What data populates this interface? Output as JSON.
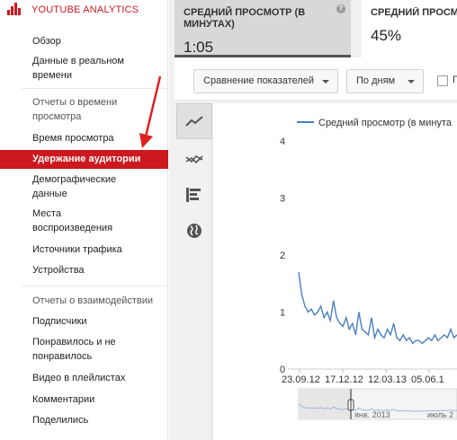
{
  "sidebar": {
    "title": "YOUTUBE ANALYTICS",
    "items": [
      {
        "label": "Обзор",
        "type": "item"
      },
      {
        "label": "Данные в реальном времени",
        "type": "item"
      },
      {
        "label": "Отчеты о времени просмотра",
        "type": "section"
      },
      {
        "label": "Время просмотра",
        "type": "item"
      },
      {
        "label": "Удержание аудитории",
        "type": "item",
        "active": true
      },
      {
        "label": "Демографические данные",
        "type": "item"
      },
      {
        "label": "Места воспроизведения",
        "type": "item"
      },
      {
        "label": "Источники трафика",
        "type": "item"
      },
      {
        "label": "Устройства",
        "type": "item"
      },
      {
        "label": "Отчеты о взаимодействии",
        "type": "section"
      },
      {
        "label": "Подписчики",
        "type": "item"
      },
      {
        "label": "Понравилось и не понравилось",
        "type": "item"
      },
      {
        "label": "Видео в плейлистах",
        "type": "item"
      },
      {
        "label": "Комментарии",
        "type": "item"
      },
      {
        "label": "Поделились",
        "type": "item"
      }
    ]
  },
  "metrics": [
    {
      "label": "Средний просмотр (в минутах)",
      "value": "1:05",
      "selected": true
    },
    {
      "label": "Средний просмо (в процентах)",
      "value": "45%",
      "selected": false
    }
  ],
  "toolbar": {
    "compare_label": "Сравнение показателей",
    "period_label": "По дням",
    "checkbox_label": "Пр"
  },
  "chart_types": [
    "line-chart-icon",
    "multi-line-chart-icon",
    "bar-chart-icon",
    "globe-map-icon"
  ],
  "colors": {
    "accent": "#cc181e",
    "line": "#4a7fc1",
    "arrow": "#e02020"
  },
  "chart_data": {
    "type": "line",
    "title": "",
    "series": [
      {
        "name": "Средний просмотр (в минута",
        "values": [
          [
            0,
            1.7
          ],
          [
            1,
            1.3
          ],
          [
            2,
            1.1
          ],
          [
            3,
            1.0
          ],
          [
            4,
            1.05
          ],
          [
            5,
            0.95
          ],
          [
            6,
            1.0
          ],
          [
            7,
            1.1
          ],
          [
            8,
            0.9
          ],
          [
            9,
            1.0
          ],
          [
            10,
            0.85
          ],
          [
            11,
            1.2
          ],
          [
            12,
            0.9
          ],
          [
            13,
            0.8
          ],
          [
            14,
            0.75
          ],
          [
            15,
            0.9
          ],
          [
            16,
            0.7
          ],
          [
            17,
            0.8
          ],
          [
            18,
            0.6
          ],
          [
            19,
            1.0
          ],
          [
            20,
            0.7
          ],
          [
            21,
            0.65
          ],
          [
            22,
            0.6
          ],
          [
            23,
            0.9
          ],
          [
            24,
            0.55
          ],
          [
            25,
            0.7
          ],
          [
            26,
            0.6
          ],
          [
            27,
            0.55
          ],
          [
            28,
            0.7
          ],
          [
            29,
            0.6
          ],
          [
            30,
            0.8
          ],
          [
            31,
            0.55
          ],
          [
            32,
            0.5
          ],
          [
            33,
            0.6
          ],
          [
            34,
            0.5
          ],
          [
            35,
            0.55
          ],
          [
            36,
            0.45
          ],
          [
            37,
            0.5
          ],
          [
            38,
            0.5
          ],
          [
            39,
            0.45
          ],
          [
            40,
            0.5
          ],
          [
            41,
            0.55
          ],
          [
            42,
            0.5
          ],
          [
            43,
            0.6
          ],
          [
            44,
            0.5
          ],
          [
            45,
            0.55
          ],
          [
            46,
            0.6
          ],
          [
            47,
            0.55
          ],
          [
            48,
            0.7
          ],
          [
            49,
            0.55
          ],
          [
            50,
            0.6
          ]
        ]
      }
    ],
    "y_ticks": [
      "0",
      "1",
      "2",
      "3",
      "4"
    ],
    "ylim": [
      0,
      4
    ],
    "x_ticks": [
      "23.09.12",
      "17.12.12",
      "12.03.13",
      "05.06.1"
    ],
    "navigator_labels": [
      "янв. 2013",
      "июль 2"
    ]
  }
}
